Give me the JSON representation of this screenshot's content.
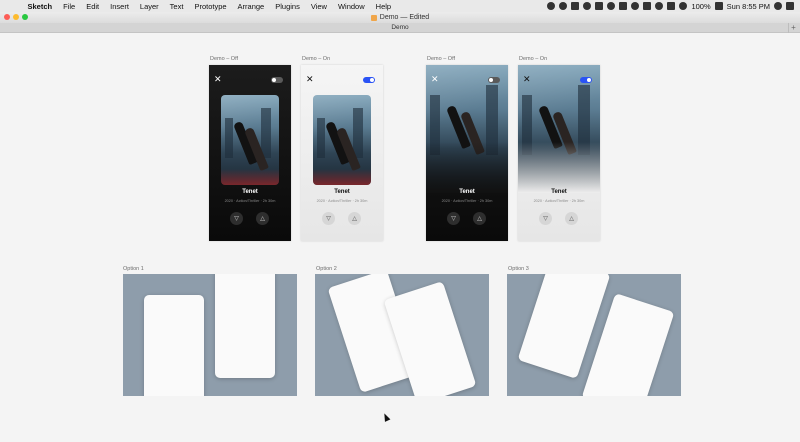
{
  "menubar": {
    "items": [
      "Sketch",
      "File",
      "Edit",
      "Insert",
      "Layer",
      "Text",
      "Prototype",
      "Arrange",
      "Plugins",
      "View",
      "Window",
      "Help"
    ],
    "battery": "100%",
    "clock": "Sun 8:55 PM"
  },
  "window": {
    "title": "Demo — Edited",
    "tab": "Demo"
  },
  "artboards": [
    {
      "label": "Demo – Off",
      "theme": "dark",
      "toggle": "off",
      "poster": "small"
    },
    {
      "label": "Demo – On",
      "theme": "light",
      "toggle": "on",
      "poster": "small"
    },
    {
      "label": "Demo – Off",
      "theme": "dark",
      "toggle": "off",
      "poster": "full"
    },
    {
      "label": "Demo – On",
      "theme": "light",
      "toggle": "on",
      "poster": "full"
    }
  ],
  "movie": {
    "title": "Tenet",
    "meta": "2020 · Action/Thriller · 2h 30m"
  },
  "options": [
    {
      "label": "Option 1"
    },
    {
      "label": "Option 2"
    },
    {
      "label": "Option 3"
    }
  ],
  "colors": {
    "toggle_on": "#2a53f5",
    "option_bg": "#8e9dab",
    "dark_phone": "#111111",
    "light_phone": "#eeeeee"
  },
  "icons": {
    "close": "close-icon",
    "thumbs_down": "thumbs-down-icon",
    "thumbs_up": "thumbs-up-icon"
  }
}
